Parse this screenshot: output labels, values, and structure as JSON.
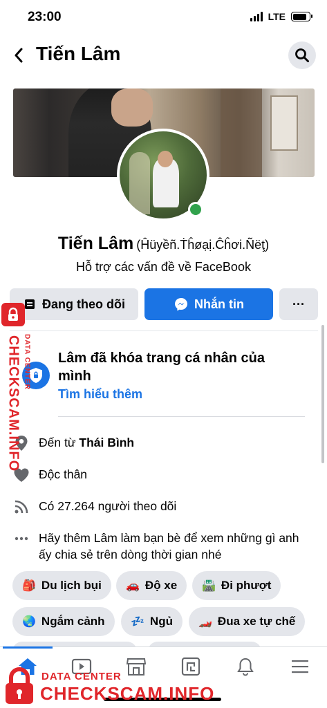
{
  "status_bar": {
    "time": "23:00",
    "network": "LTE",
    "battery_level": 0.85
  },
  "header": {
    "title": "Tiến Lâm",
    "back_icon": "chevron-left-icon",
    "search_icon": "search-icon"
  },
  "profile": {
    "name": "Tiến Lâm",
    "alternate_name": "(Ĥüyềñ.Ṫĥøạị.Ĉĥơi.Ñëţ)",
    "bio": "Hỗ trợ các vấn đề về FaceBook",
    "online": true
  },
  "actions": {
    "following_label": "Đang theo dõi",
    "message_label": "Nhắn tin",
    "more_label": "···"
  },
  "locked_notice": {
    "title": "Lâm đã khóa trang cá nhân của mình",
    "link": "Tìm hiểu thêm"
  },
  "intro": {
    "hometown_prefix": "Đến từ ",
    "hometown": "Thái Bình",
    "relationship": "Độc thân",
    "followers": "Có 27.264 người theo dõi",
    "friend_prompt": "Hãy thêm Lâm làm bạn bè để xem những gì anh ấy chia sẻ trên dòng thời gian nhé"
  },
  "hobbies": [
    {
      "emoji": "🎒",
      "label": "Du lịch bụi"
    },
    {
      "emoji": "🚗",
      "label": "Độ xe"
    },
    {
      "emoji": "🛣️",
      "label": "Đi phượt"
    },
    {
      "emoji": "🌏",
      "label": "Ngắm cảnh"
    },
    {
      "emoji": "💤",
      "label": "Ngủ"
    },
    {
      "emoji": "🏎️",
      "label": "Đua xe tự chế"
    }
  ],
  "tab_bar": {
    "tabs": [
      "home-icon",
      "video-icon",
      "marketplace-icon",
      "gaming-icon",
      "notifications-icon",
      "menu-icon"
    ],
    "active": "home-icon"
  },
  "watermark": {
    "small": "DATA CENTER",
    "big": "CHECKSCAM.INFO",
    "color": "#e0262b"
  },
  "colors": {
    "accent": "#1b74e4",
    "online": "#31a24c",
    "button_gray": "#e4e6eb"
  }
}
